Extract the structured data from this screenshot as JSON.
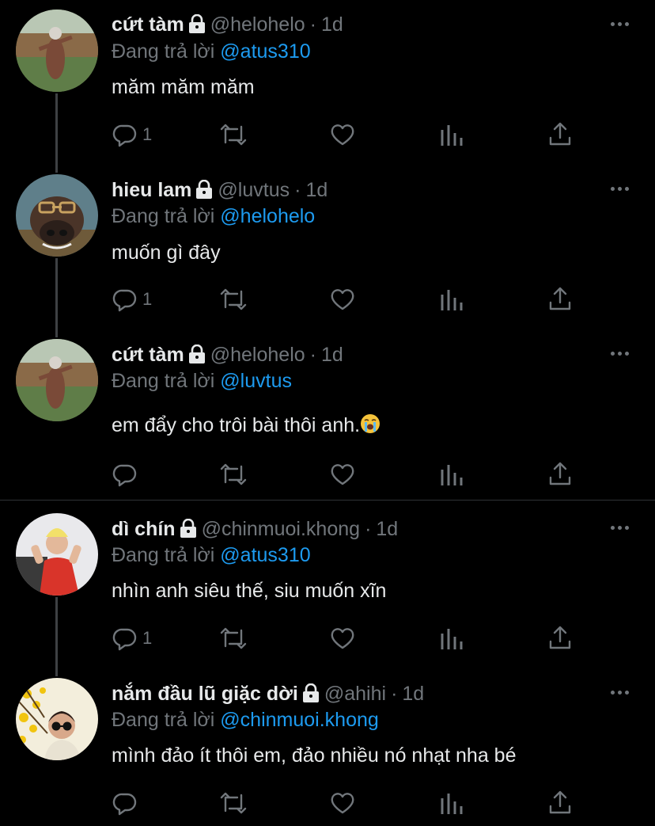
{
  "colors": {
    "background": "#000000",
    "text": "#e7e9ea",
    "muted": "#71767b",
    "mention": "#1d9bf0",
    "thread": "#3e4144"
  },
  "tweets": [
    {
      "name": "cứt tàm",
      "handle": "@helohelo",
      "separator": "·",
      "time": "1d",
      "reply_prefix": "Đang trả lời",
      "reply_to": "@atus310",
      "text": "măm măm măm",
      "reply_count": "1"
    },
    {
      "name": "hieu lam",
      "handle": "@luvtus",
      "separator": "·",
      "time": "1d",
      "reply_prefix": "Đang trả lời",
      "reply_to": "@helohelo",
      "text": "muốn gì đây",
      "reply_count": "1"
    },
    {
      "name": "cứt tàm",
      "handle": "@helohelo",
      "separator": "·",
      "time": "1d",
      "reply_prefix": "Đang trả lời",
      "reply_to": "@luvtus",
      "text": "em đẩy cho trôi bài thôi anh.",
      "emoji": "loudly-crying-face",
      "reply_count": ""
    },
    {
      "name": "dì chín",
      "handle": "@chinmuoi.khong",
      "separator": "·",
      "time": "1d",
      "reply_prefix": "Đang trả lời",
      "reply_to": "@atus310",
      "text": "nhìn anh siêu thế, siu muốn xĩn",
      "reply_count": "1"
    },
    {
      "name": "nắm đầu lũ giặc dời",
      "handle": "@ahihi",
      "separator": "·",
      "time": "1d",
      "reply_prefix": "Đang trả lời",
      "reply_to": "@chinmuoi.khong",
      "text": "mình đảo ít thôi em, đảo nhiều nó nhạt nha bé",
      "reply_count": ""
    }
  ],
  "icons": [
    "lock-icon",
    "more-icon",
    "reply-icon",
    "retweet-icon",
    "like-icon",
    "analytics-icon",
    "share-icon"
  ]
}
